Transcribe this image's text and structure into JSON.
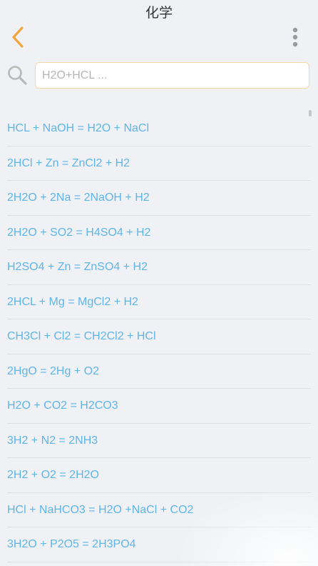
{
  "header": {
    "title": "化学"
  },
  "search": {
    "placeholder": "H2O+HCL ..."
  },
  "colors": {
    "accent": "#f2a53a",
    "link": "#5fb5e8",
    "background": "#eff1f4",
    "icon": "#9a9a9a"
  },
  "equations": [
    {
      "label": "HCL + NaOH = H2O + NaCl"
    },
    {
      "label": "2HCl + Zn = ZnCl2 + H2"
    },
    {
      "label": "2H2O + 2Na = 2NaOH + H2"
    },
    {
      "label": "2H2O + SO2 = H4SO4 + H2"
    },
    {
      "label": "H2SO4 + Zn = ZnSO4 + H2"
    },
    {
      "label": "2HCL + Mg = MgCl2 + H2"
    },
    {
      "label": "CH3Cl + Cl2 = CH2Cl2 + HCl"
    },
    {
      "label": "2HgO = 2Hg + O2"
    },
    {
      "label": "H2O + CO2 = H2CO3"
    },
    {
      "label": "3H2 + N2 = 2NH3"
    },
    {
      "label": "2H2 + O2 = 2H2O"
    },
    {
      "label": "HCl + NaHCO3 = H2O +NaCl + CO2"
    },
    {
      "label": "3H2O + P2O5 = 2H3PO4"
    }
  ]
}
